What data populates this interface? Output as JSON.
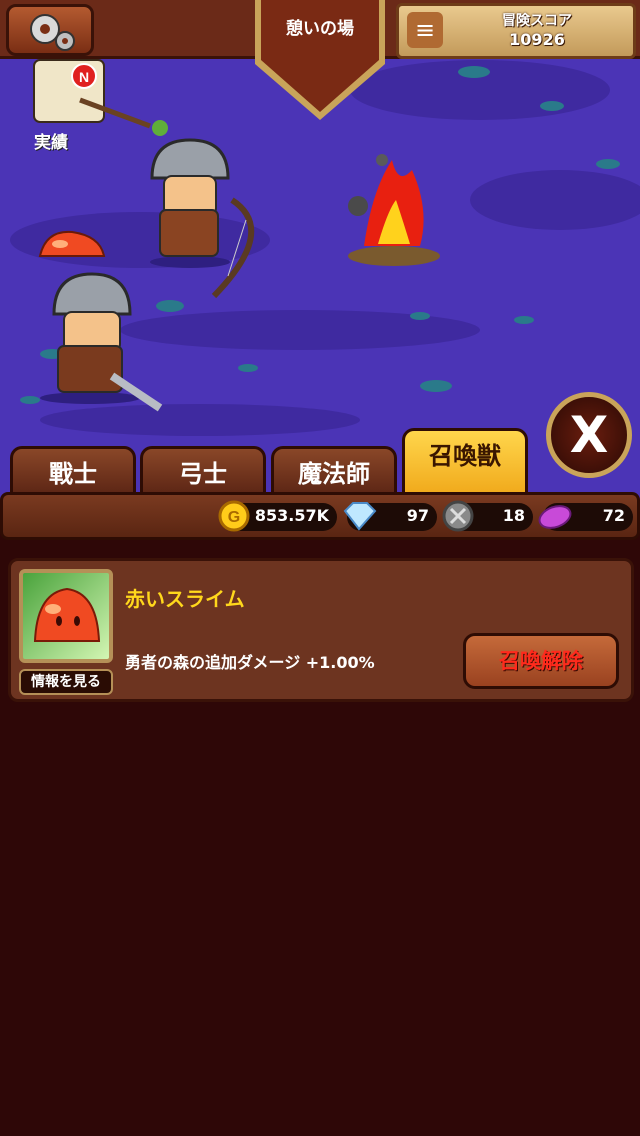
{
  "header": {
    "settings_icon": "gear-icon",
    "location_title": "憩いの場",
    "menu_icon": "hamburger-icon",
    "score_label": "冒険スコア",
    "score_value": "10926"
  },
  "scene": {
    "achievement_label": "実績",
    "achievement_badge": "N",
    "close_label": "X"
  },
  "tabs": [
    {
      "label": "戰士",
      "active": false
    },
    {
      "label": "弓士",
      "active": false
    },
    {
      "label": "魔法師",
      "active": false
    },
    {
      "label": "召喚獣",
      "active": true
    }
  ],
  "currencies": {
    "gold": {
      "icon": "gold-coin-icon",
      "value": "853.57K"
    },
    "diamond": {
      "icon": "diamond-icon",
      "value": "97"
    },
    "emblem": {
      "icon": "shield-emblem-icon",
      "value": "18"
    },
    "gem": {
      "icon": "purple-gem-icon",
      "value": "72"
    }
  },
  "summon": {
    "name": "赤いスライム",
    "description": "勇者の森の追加ダメージ +1.00%",
    "info_button": "情報を見る",
    "unsummon_button": "召喚解除"
  },
  "colors": {
    "scene_bg": "#4b34b6",
    "panel_bg": "#2e0707",
    "accent_gold": "#ffd81c",
    "unsummon_text": "#ff2a1c"
  }
}
